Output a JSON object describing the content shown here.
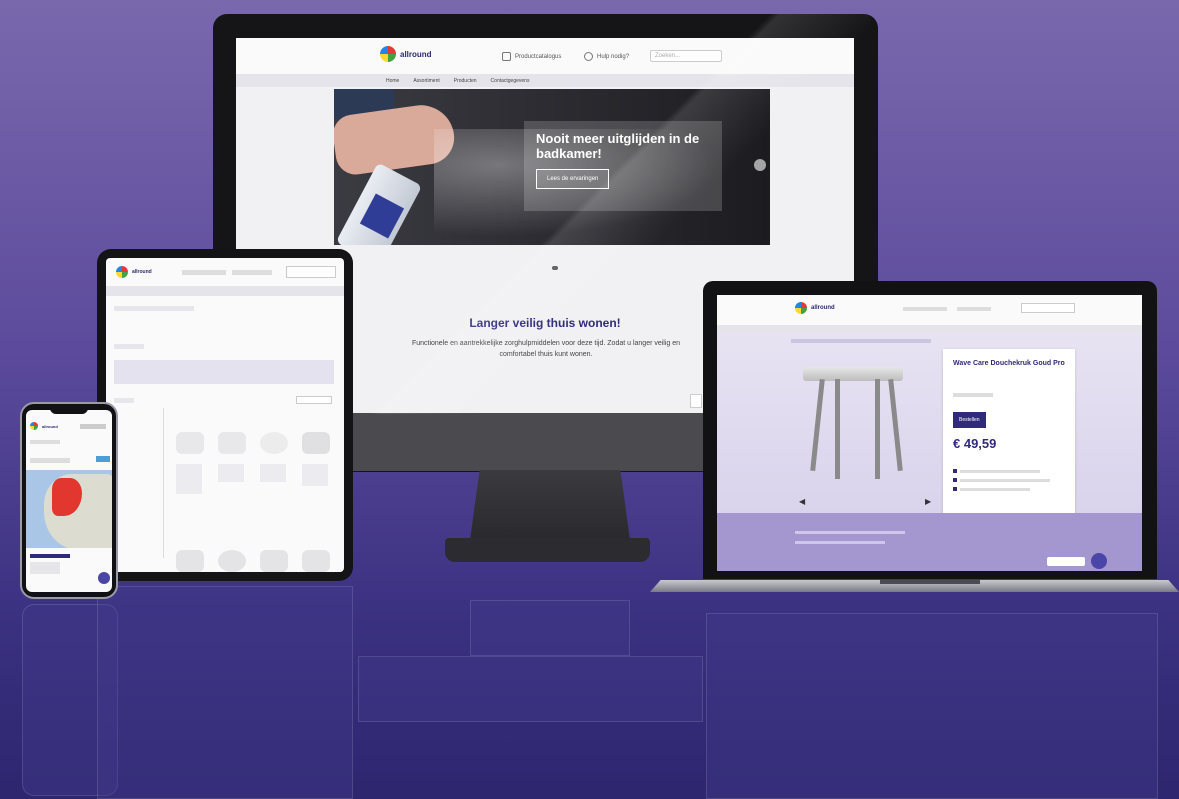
{
  "desktop": {
    "brand": "allround",
    "header_links": [
      "Productcatalogus",
      "Hulp nodig?"
    ],
    "search_placeholder": "Zoeken...",
    "nav": [
      "Home",
      "Assortiment",
      "Producten",
      "Contactgegevens"
    ],
    "hero_title": "Nooit meer uitglijden in de badkamer!",
    "hero_button": "Lees de ervaringen",
    "section_title": "Langer veilig thuis wonen!",
    "section_text": "Functionele en aantrekkelijke zorghulpmiddelen voor deze tijd. Zodat u langer veilig en comfortabel thuis kunt wonen."
  },
  "laptop": {
    "brand": "allround",
    "product_title": "Wave Care Douchekruk Goud Pro",
    "product_button": "Bestellen",
    "price": "€ 49,59"
  },
  "tablet": {
    "brand": "allround"
  },
  "phone": {
    "brand": "allround"
  },
  "colors": {
    "accent": "#2f2b7a",
    "background_top": "#7a68ad",
    "background_bottom": "#332b78"
  },
  "icons": [
    "phone-icon",
    "catalog-icon",
    "chat-icon",
    "arrow-right-icon",
    "arrow-left-icon"
  ]
}
